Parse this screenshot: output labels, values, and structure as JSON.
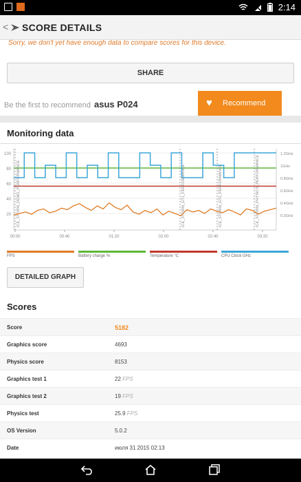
{
  "status": {
    "time": "2:14"
  },
  "appbar": {
    "back_glyph": "<",
    "title": "SCORE DETAILS"
  },
  "notice": "Sorry, we don't yet have enough data to compare scores for this device.",
  "share": {
    "label": "SHARE"
  },
  "recommend": {
    "prompt": "Be the first to recommend",
    "device": "asus P024",
    "button": "Recommend"
  },
  "monitoring": {
    "title": "Monitoring data",
    "detailed_button": "DETAILED GRAPH"
  },
  "chart_data": {
    "type": "line",
    "x_ticks": [
      "00:00",
      "00:40",
      "01:20",
      "02:00",
      "02:40",
      "03:20"
    ],
    "y_left_ticks": [
      "100",
      "80",
      "60",
      "40",
      "20"
    ],
    "y_right_ticks": [
      "1.2GHz",
      "1GHz",
      "0.8GHz",
      "0.6GHz",
      "0.4GHz",
      "0.2GHz"
    ],
    "markers": [
      "ICE_STORM_DEMO_PERFORMANCE",
      "ICE_STORM_GT1_PERFORMANCE",
      "ICE_STORM_GT2_PERFORMANCE",
      "ICE_STORM_PHYSICS_PERFORMANCE"
    ],
    "legend": [
      {
        "name": "FPS",
        "color": "#e07b24"
      },
      {
        "name": "Battery charge %",
        "color": "#5cb83a"
      },
      {
        "name": "Temperature °C",
        "color": "#c0392b"
      },
      {
        "name": "CPU Clock GHz",
        "color": "#3aa6d8"
      }
    ],
    "battery_pct": 80,
    "temperature_c": 36,
    "cpu_ghz_levels": [
      0.8,
      1.2,
      0.8,
      1.0,
      0.8,
      1.2,
      0.8,
      1.0,
      0.8,
      1.2,
      0.8,
      0.8,
      1.2,
      1.0,
      0.8,
      1.2,
      0.8,
      0.8,
      1.2,
      1.0,
      0.8,
      1.2,
      1.2,
      1.2,
      1.2
    ],
    "fps": [
      18,
      20,
      22,
      19,
      24,
      26,
      21,
      23,
      27,
      25,
      30,
      33,
      28,
      24,
      30,
      26,
      34,
      28,
      25,
      31,
      22,
      19,
      24,
      21,
      26,
      18,
      23,
      20,
      17,
      25,
      22,
      24,
      20,
      26,
      23,
      21,
      25,
      22,
      18,
      26,
      24,
      19,
      23,
      25,
      27
    ]
  },
  "scores": {
    "title": "Scores",
    "rows": [
      {
        "label": "Score",
        "value": "5182",
        "unit": ""
      },
      {
        "label": "Graphics score",
        "value": "4693",
        "unit": ""
      },
      {
        "label": "Physics score",
        "value": "8153",
        "unit": ""
      },
      {
        "label": "Graphics test 1",
        "value": "22",
        "unit": "FPS"
      },
      {
        "label": "Graphics test 2",
        "value": "19",
        "unit": "FPS"
      },
      {
        "label": "Physics test",
        "value": "25.9",
        "unit": "FPS"
      },
      {
        "label": "OS Version",
        "value": "5.0.2",
        "unit": ""
      },
      {
        "label": "Date",
        "value": "июля 31 2015 02:13",
        "unit": ""
      }
    ]
  },
  "navbar": {
    "back": "back-icon",
    "home": "home-icon",
    "recents": "recents-icon"
  }
}
